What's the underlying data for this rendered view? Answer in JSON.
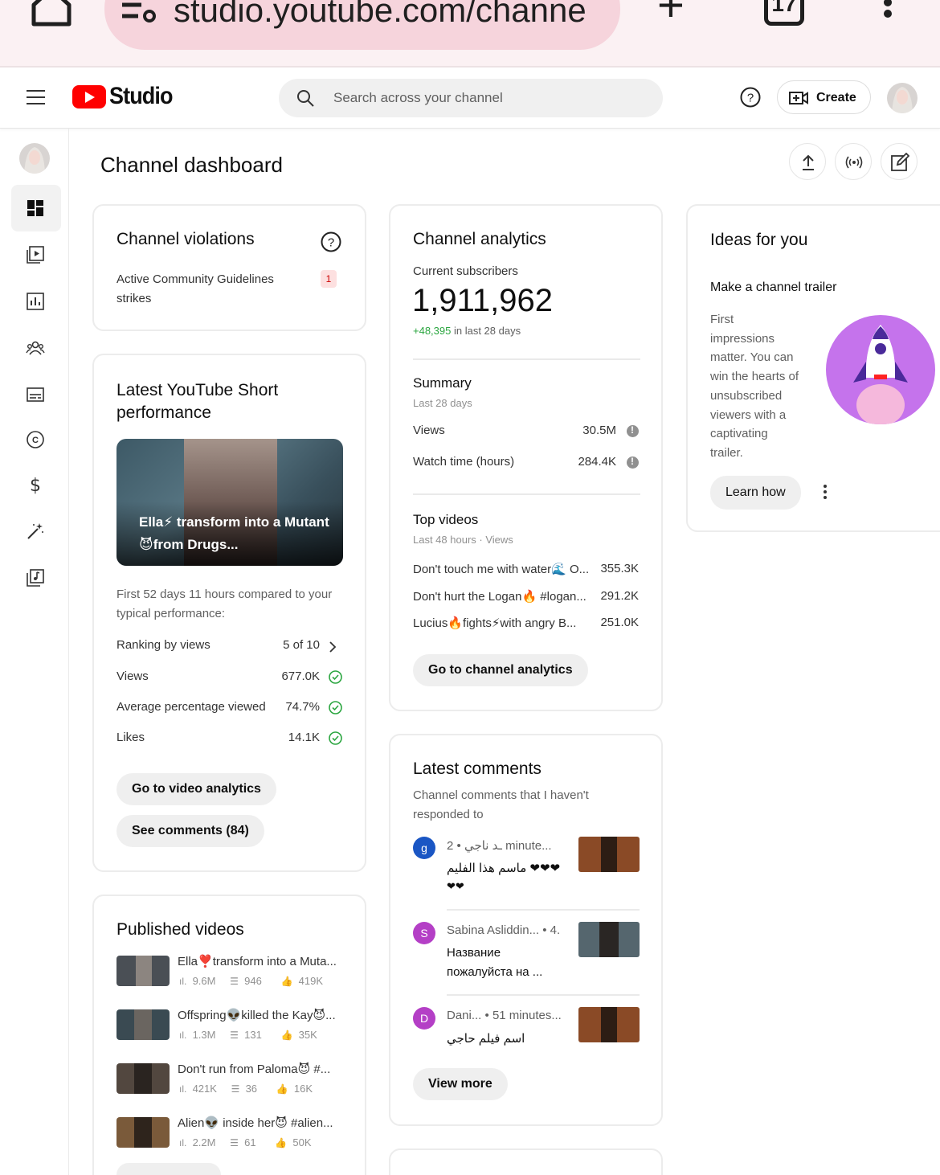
{
  "browser": {
    "url": "studio.youtube.com/channe",
    "tab_count": "17"
  },
  "header": {
    "logo_text": "Studio",
    "search_placeholder": "Search across your channel",
    "create_label": "Create"
  },
  "page": {
    "title": "Channel dashboard"
  },
  "violations": {
    "title": "Channel violations",
    "label": "Active Community Guidelines strikes",
    "count": "1"
  },
  "short_performance": {
    "title": "Latest YouTube Short performance",
    "thumb_caption": "Ella⚡ transform into a Mutant😈from Drugs...",
    "compare_text": "First 52 days 11 hours compared to your typical performance:",
    "rows": [
      {
        "label": "Ranking by views",
        "value": "5 of 10"
      },
      {
        "label": "Views",
        "value": "677.0K"
      },
      {
        "label": "Average percentage viewed",
        "value": "74.7%"
      },
      {
        "label": "Likes",
        "value": "14.1K"
      }
    ],
    "btn_analytics": "Go to video analytics",
    "btn_comments": "See comments (84)"
  },
  "published": {
    "title": "Published videos",
    "videos": [
      {
        "title": "Ella❣️transform into a Muta...",
        "views": "9.6M",
        "comments": "946",
        "likes": "419K"
      },
      {
        "title": "Offspring👽killed the Kay😈...",
        "views": "1.3M",
        "comments": "131",
        "likes": "35K"
      },
      {
        "title": "Don't run from Paloma😈 #...",
        "views": "421K",
        "comments": "36",
        "likes": "16K"
      },
      {
        "title": "Alien👽 inside her😈 #alien...",
        "views": "2.2M",
        "comments": "61",
        "likes": "50K"
      }
    ]
  },
  "analytics": {
    "title": "Channel analytics",
    "subs_label": "Current subscribers",
    "subs_value": "1,911,962",
    "subs_delta": "+48,395",
    "subs_delta_suffix": "in last 28 days",
    "summary_title": "Summary",
    "summary_period": "Last 28 days",
    "summary_rows": [
      {
        "label": "Views",
        "value": "30.5M"
      },
      {
        "label": "Watch time (hours)",
        "value": "284.4K"
      }
    ],
    "top_title": "Top videos",
    "top_period": "Last 48 hours · Views",
    "top_videos": [
      {
        "title": "Don't touch me with water🌊 O...",
        "views": "355.3K"
      },
      {
        "title": "Don't hurt the Logan🔥 #logan...",
        "views": "291.2K"
      },
      {
        "title": "Lucius🔥fights⚡with angry B...",
        "views": "251.0K"
      }
    ],
    "btn": "Go to channel analytics"
  },
  "comments": {
    "title": "Latest comments",
    "subtitle": "Channel comments that I haven't responded to",
    "items": [
      {
        "initial": "g",
        "author": "ـد ناجي",
        "time": "• 2 minute...",
        "text1": "ماسم هذا الفليم ❤❤❤",
        "text2": "❤❤",
        "color": "#1a56c4"
      },
      {
        "initial": "S",
        "author": "Sabina Asliddin...",
        "time": "• 4.",
        "text1": "Название",
        "text2": "пожалуйста на ...",
        "color": "#b43fc6"
      },
      {
        "initial": "D",
        "author": "Dani...",
        "time": "• 51 minutes...",
        "text1": "اسم فيلم حاجي",
        "text2": "",
        "color": "#b43fc6"
      }
    ],
    "btn": "View more"
  },
  "ideas": {
    "title": "Ideas for you",
    "heading": "Make a channel trailer",
    "lines": [
      "First",
      "impressions",
      "matter. You can",
      "win the hearts of",
      "unsubscribed",
      "viewers with a",
      "captivating",
      "trailer."
    ],
    "btn": "Learn how"
  },
  "colors": {
    "accent_red": "#ff0000",
    "positive_green": "#2ba640",
    "strike_badge_bg": "#fde0e0",
    "strike_badge_text": "#cc0000",
    "idea_circle": "#c573ec"
  }
}
